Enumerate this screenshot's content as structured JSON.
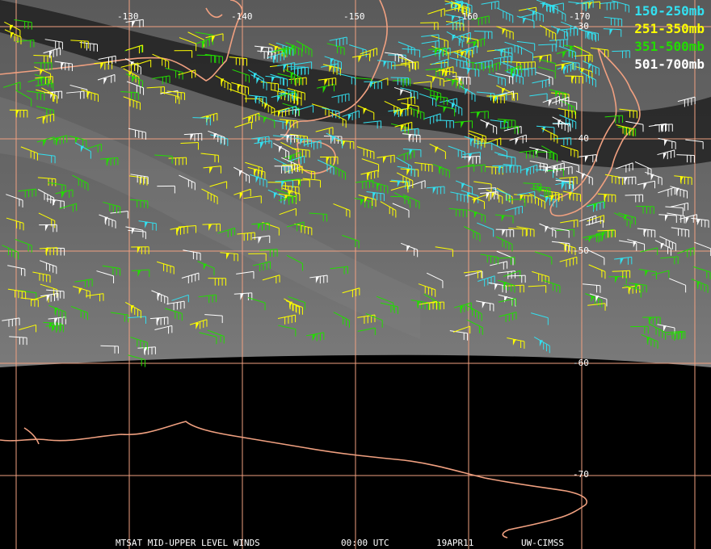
{
  "map": {
    "longitude_labels": [
      "-130",
      "-140",
      "-150",
      "-160",
      "-170"
    ],
    "latitude_labels": [
      "-30",
      "-40",
      "-50",
      "-60",
      "-70"
    ],
    "grid_color": "#f0a080",
    "coast_color": "#f0a080"
  },
  "legend": [
    {
      "label": "150-250mb",
      "color": "#33e0f0"
    },
    {
      "label": "251-350mb",
      "color": "#ffff00"
    },
    {
      "label": "351-500mb",
      "color": "#22dd00"
    },
    {
      "label": "501-700mb",
      "color": "#ffffff"
    }
  ],
  "footer": {
    "product": "MTSAT MID-UPPER LEVEL WINDS",
    "time": "00:00 UTC",
    "date": "19APR11",
    "source": "UW-CIMSS"
  }
}
